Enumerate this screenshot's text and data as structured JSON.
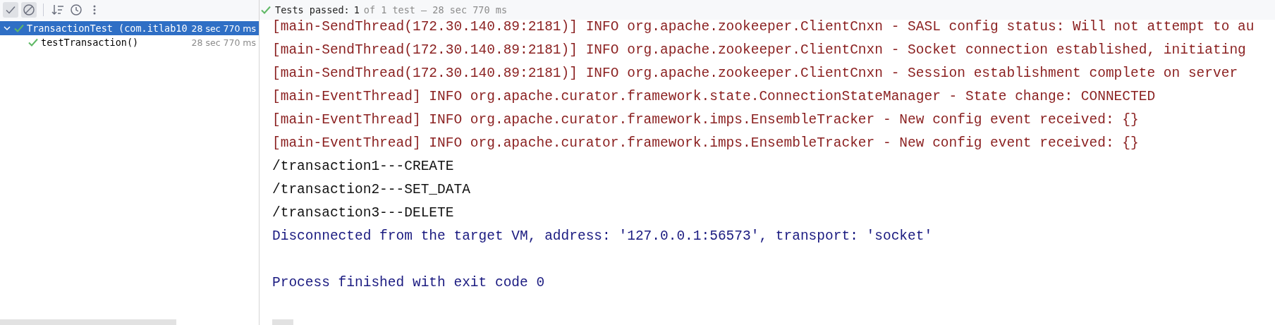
{
  "toolbar": {
    "buttons": [
      {
        "kind": "check",
        "selected": true
      },
      {
        "kind": "ignored",
        "selected": true
      },
      {
        "kind": "sort",
        "selected": false
      },
      {
        "kind": "clock",
        "selected": false
      },
      {
        "kind": "more",
        "selected": false
      }
    ]
  },
  "summary": {
    "label": "Tests passed:",
    "count": "1",
    "detail": "of 1 test – 28 sec 770 ms"
  },
  "tree": [
    {
      "name": "TransactionTest (com.itlab10",
      "time": "28 sec 770 ms",
      "passed": true,
      "selected": true,
      "expanded": true,
      "children": [
        {
          "name": "testTransaction()",
          "time": "28 sec 770 ms",
          "passed": true,
          "selected": false
        }
      ]
    }
  ],
  "console": [
    {
      "kind": "info",
      "text": "[main-SendThread(172.30.140.89:2181)] INFO org.apache.zookeeper.ClientCnxn - SASL config status: Will not attempt to au"
    },
    {
      "kind": "info",
      "text": "[main-SendThread(172.30.140.89:2181)] INFO org.apache.zookeeper.ClientCnxn - Socket connection established, initiating"
    },
    {
      "kind": "info",
      "text": "[main-SendThread(172.30.140.89:2181)] INFO org.apache.zookeeper.ClientCnxn - Session establishment complete on server"
    },
    {
      "kind": "info",
      "text": "[main-EventThread] INFO org.apache.curator.framework.state.ConnectionStateManager - State change: CONNECTED"
    },
    {
      "kind": "info",
      "text": "[main-EventThread] INFO org.apache.curator.framework.imps.EnsembleTracker - New config event received: {}"
    },
    {
      "kind": "info",
      "text": "[main-EventThread] INFO org.apache.curator.framework.imps.EnsembleTracker - New config event received: {}"
    },
    {
      "kind": "out",
      "text": "/transaction1---CREATE"
    },
    {
      "kind": "out",
      "text": "/transaction2---SET_DATA"
    },
    {
      "kind": "out",
      "text": "/transaction3---DELETE"
    },
    {
      "kind": "system",
      "text": "Disconnected from the target VM, address: '127.0.0.1:56573', transport: 'socket'"
    },
    {
      "kind": "blank"
    },
    {
      "kind": "system",
      "text": "Process finished with exit code 0"
    }
  ]
}
